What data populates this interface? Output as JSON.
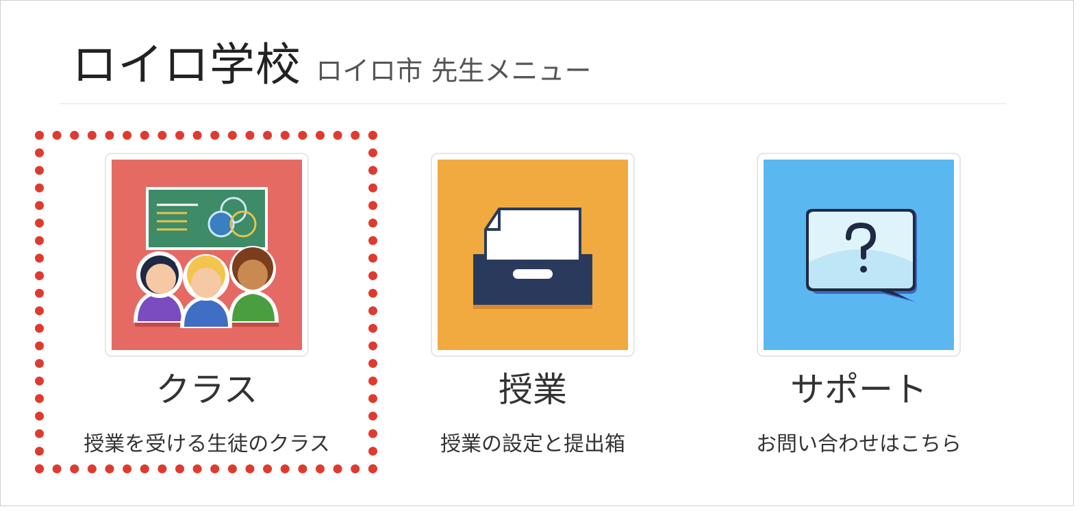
{
  "header": {
    "school_name": "ロイロ学校",
    "sub_title": "ロイロ市 先生メニュー"
  },
  "menu": {
    "items": [
      {
        "title": "クラス",
        "description": "授業を受ける生徒のクラス",
        "icon": "class-students-icon",
        "color": "#e56a63",
        "highlighted": true
      },
      {
        "title": "授業",
        "description": "授業の設定と提出箱",
        "icon": "file-drawer-icon",
        "color": "#f0aa3f",
        "highlighted": false
      },
      {
        "title": "サポート",
        "description": "お問い合わせはこちら",
        "icon": "help-speech-bubble-icon",
        "color": "#5bb7f0",
        "highlighted": false
      }
    ]
  },
  "highlight_color": "#e03a2f"
}
